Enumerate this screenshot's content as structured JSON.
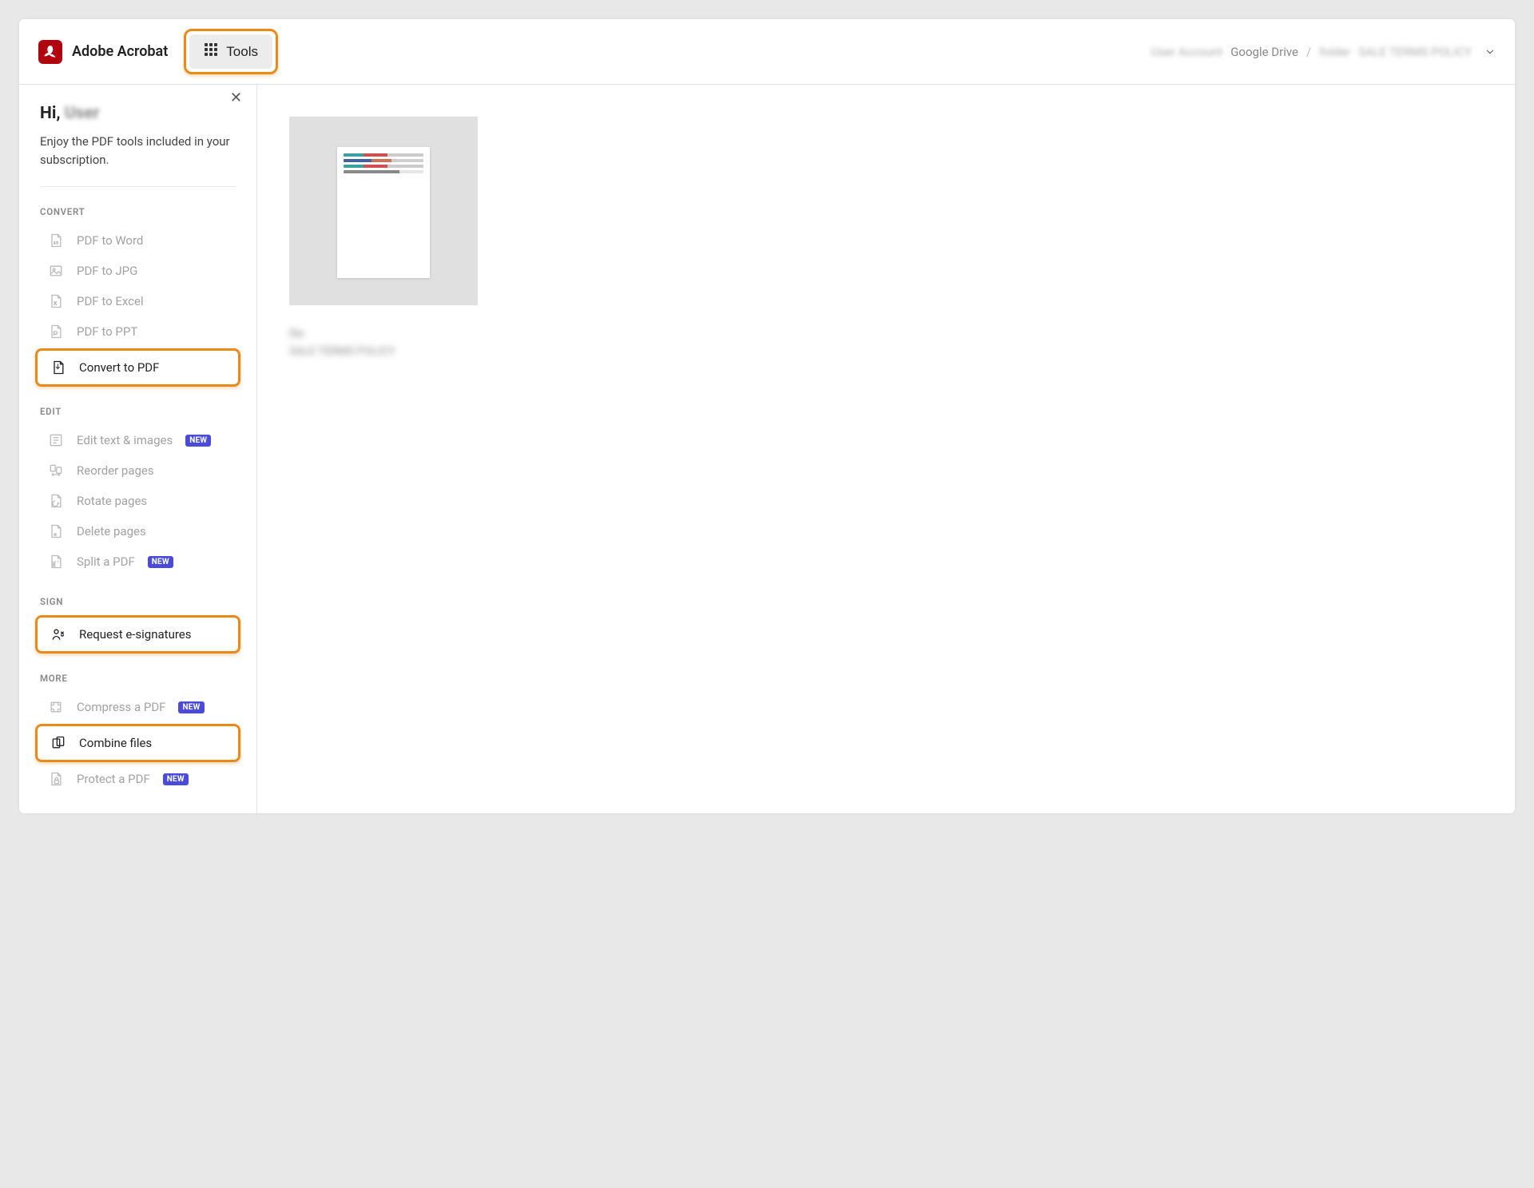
{
  "header": {
    "app_title": "Adobe Acrobat",
    "tools_label": "Tools",
    "breadcrumb": {
      "account_blur": "User Account",
      "drive_label": "Google Drive",
      "path_sep": "/",
      "folder_blur": "folder",
      "file_blur": "SALE TERMS POLICY"
    }
  },
  "sidebar": {
    "greeting_prefix": "Hi, ",
    "greeting_name_blur": "User",
    "subgreeting": "Enjoy the PDF tools included in your subscription.",
    "badge_new": "NEW",
    "sections": {
      "convert": {
        "label": "CONVERT",
        "items": [
          {
            "label": "PDF to Word"
          },
          {
            "label": "PDF to JPG"
          },
          {
            "label": "PDF to Excel"
          },
          {
            "label": "PDF to PPT"
          },
          {
            "label": "Convert to PDF",
            "highlighted": true
          }
        ]
      },
      "edit": {
        "label": "EDIT",
        "items": [
          {
            "label": "Edit text & images",
            "new": true
          },
          {
            "label": "Reorder pages"
          },
          {
            "label": "Rotate pages"
          },
          {
            "label": "Delete pages"
          },
          {
            "label": "Split a PDF",
            "new": true
          }
        ]
      },
      "sign": {
        "label": "SIGN",
        "items": [
          {
            "label": "Request e-signatures",
            "highlighted": true
          }
        ]
      },
      "more": {
        "label": "MORE",
        "items": [
          {
            "label": "Compress a PDF",
            "new": true
          },
          {
            "label": "Combine files",
            "highlighted": true
          },
          {
            "label": "Protect a PDF",
            "new": true
          }
        ]
      }
    }
  },
  "main": {
    "doc_name_blur": "file",
    "doc_title_blur": "SALE TERMS POLICY"
  }
}
